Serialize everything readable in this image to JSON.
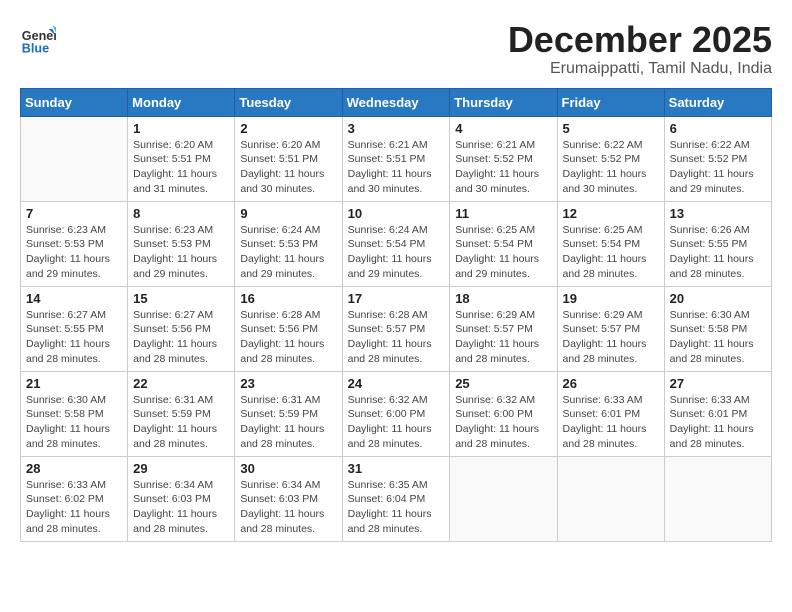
{
  "logo": {
    "general": "General",
    "blue": "Blue"
  },
  "title": "December 2025",
  "subtitle": "Erumaippatti, Tamil Nadu, India",
  "headers": [
    "Sunday",
    "Monday",
    "Tuesday",
    "Wednesday",
    "Thursday",
    "Friday",
    "Saturday"
  ],
  "weeks": [
    [
      {
        "day": "",
        "info": ""
      },
      {
        "day": "1",
        "info": "Sunrise: 6:20 AM\nSunset: 5:51 PM\nDaylight: 11 hours\nand 31 minutes."
      },
      {
        "day": "2",
        "info": "Sunrise: 6:20 AM\nSunset: 5:51 PM\nDaylight: 11 hours\nand 30 minutes."
      },
      {
        "day": "3",
        "info": "Sunrise: 6:21 AM\nSunset: 5:51 PM\nDaylight: 11 hours\nand 30 minutes."
      },
      {
        "day": "4",
        "info": "Sunrise: 6:21 AM\nSunset: 5:52 PM\nDaylight: 11 hours\nand 30 minutes."
      },
      {
        "day": "5",
        "info": "Sunrise: 6:22 AM\nSunset: 5:52 PM\nDaylight: 11 hours\nand 30 minutes."
      },
      {
        "day": "6",
        "info": "Sunrise: 6:22 AM\nSunset: 5:52 PM\nDaylight: 11 hours\nand 29 minutes."
      }
    ],
    [
      {
        "day": "7",
        "info": "Sunrise: 6:23 AM\nSunset: 5:53 PM\nDaylight: 11 hours\nand 29 minutes."
      },
      {
        "day": "8",
        "info": "Sunrise: 6:23 AM\nSunset: 5:53 PM\nDaylight: 11 hours\nand 29 minutes."
      },
      {
        "day": "9",
        "info": "Sunrise: 6:24 AM\nSunset: 5:53 PM\nDaylight: 11 hours\nand 29 minutes."
      },
      {
        "day": "10",
        "info": "Sunrise: 6:24 AM\nSunset: 5:54 PM\nDaylight: 11 hours\nand 29 minutes."
      },
      {
        "day": "11",
        "info": "Sunrise: 6:25 AM\nSunset: 5:54 PM\nDaylight: 11 hours\nand 29 minutes."
      },
      {
        "day": "12",
        "info": "Sunrise: 6:25 AM\nSunset: 5:54 PM\nDaylight: 11 hours\nand 28 minutes."
      },
      {
        "day": "13",
        "info": "Sunrise: 6:26 AM\nSunset: 5:55 PM\nDaylight: 11 hours\nand 28 minutes."
      }
    ],
    [
      {
        "day": "14",
        "info": "Sunrise: 6:27 AM\nSunset: 5:55 PM\nDaylight: 11 hours\nand 28 minutes."
      },
      {
        "day": "15",
        "info": "Sunrise: 6:27 AM\nSunset: 5:56 PM\nDaylight: 11 hours\nand 28 minutes."
      },
      {
        "day": "16",
        "info": "Sunrise: 6:28 AM\nSunset: 5:56 PM\nDaylight: 11 hours\nand 28 minutes."
      },
      {
        "day": "17",
        "info": "Sunrise: 6:28 AM\nSunset: 5:57 PM\nDaylight: 11 hours\nand 28 minutes."
      },
      {
        "day": "18",
        "info": "Sunrise: 6:29 AM\nSunset: 5:57 PM\nDaylight: 11 hours\nand 28 minutes."
      },
      {
        "day": "19",
        "info": "Sunrise: 6:29 AM\nSunset: 5:57 PM\nDaylight: 11 hours\nand 28 minutes."
      },
      {
        "day": "20",
        "info": "Sunrise: 6:30 AM\nSunset: 5:58 PM\nDaylight: 11 hours\nand 28 minutes."
      }
    ],
    [
      {
        "day": "21",
        "info": "Sunrise: 6:30 AM\nSunset: 5:58 PM\nDaylight: 11 hours\nand 28 minutes."
      },
      {
        "day": "22",
        "info": "Sunrise: 6:31 AM\nSunset: 5:59 PM\nDaylight: 11 hours\nand 28 minutes."
      },
      {
        "day": "23",
        "info": "Sunrise: 6:31 AM\nSunset: 5:59 PM\nDaylight: 11 hours\nand 28 minutes."
      },
      {
        "day": "24",
        "info": "Sunrise: 6:32 AM\nSunset: 6:00 PM\nDaylight: 11 hours\nand 28 minutes."
      },
      {
        "day": "25",
        "info": "Sunrise: 6:32 AM\nSunset: 6:00 PM\nDaylight: 11 hours\nand 28 minutes."
      },
      {
        "day": "26",
        "info": "Sunrise: 6:33 AM\nSunset: 6:01 PM\nDaylight: 11 hours\nand 28 minutes."
      },
      {
        "day": "27",
        "info": "Sunrise: 6:33 AM\nSunset: 6:01 PM\nDaylight: 11 hours\nand 28 minutes."
      }
    ],
    [
      {
        "day": "28",
        "info": "Sunrise: 6:33 AM\nSunset: 6:02 PM\nDaylight: 11 hours\nand 28 minutes."
      },
      {
        "day": "29",
        "info": "Sunrise: 6:34 AM\nSunset: 6:03 PM\nDaylight: 11 hours\nand 28 minutes."
      },
      {
        "day": "30",
        "info": "Sunrise: 6:34 AM\nSunset: 6:03 PM\nDaylight: 11 hours\nand 28 minutes."
      },
      {
        "day": "31",
        "info": "Sunrise: 6:35 AM\nSunset: 6:04 PM\nDaylight: 11 hours\nand 28 minutes."
      },
      {
        "day": "",
        "info": ""
      },
      {
        "day": "",
        "info": ""
      },
      {
        "day": "",
        "info": ""
      }
    ]
  ]
}
